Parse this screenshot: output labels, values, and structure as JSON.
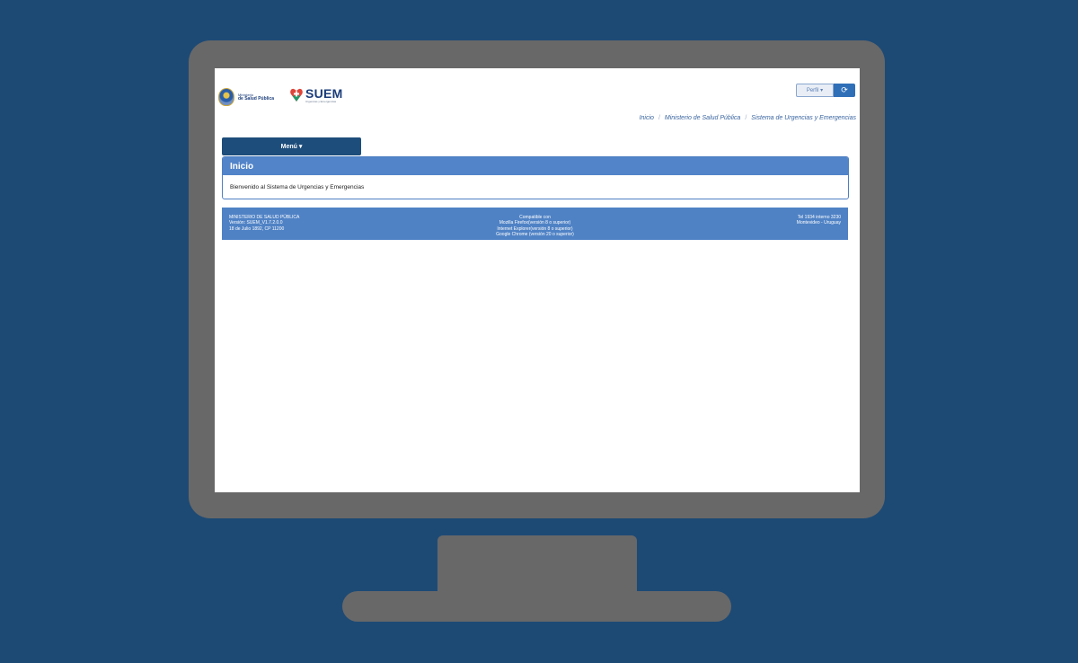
{
  "header": {
    "msp_logo": {
      "line1": "Ministerio",
      "line2": "de Salud Pública"
    },
    "suem_logo": {
      "title": "SUEM",
      "subtitle": "Urgencias y Emergencias"
    },
    "profile_button": "Perfil ▾",
    "logout_icon": "logout-icon"
  },
  "breadcrumb": [
    "Inicio",
    "Ministerio de Salud Pública",
    "Sistema de Urgencias y Emergencias"
  ],
  "menu": {
    "label": "Menú ▾"
  },
  "panel": {
    "title": "Inicio",
    "body": "Bienvenido al Sistema de Urgencias y Emergencias"
  },
  "footer": {
    "left": [
      "MINISTERIO DE SALUD PÚBLICA",
      "Versión: SUEM_V1.7.2.0.0",
      "18 de Julio 1892, CP 11200"
    ],
    "center": [
      "Compatible con",
      "Mozilla Firefox(versión 8 o superior)",
      "Internet Explorer(versión 8 o superior)",
      "Google Chrome (versión 20 o superior)"
    ],
    "right": [
      "Tel 1934 interno 3230",
      "Montevideo - Uruguay"
    ]
  },
  "colors": {
    "background": "#1d4a75",
    "monitor": "#686868",
    "accent": "#5184c8",
    "menu": "#1d4d7a"
  }
}
